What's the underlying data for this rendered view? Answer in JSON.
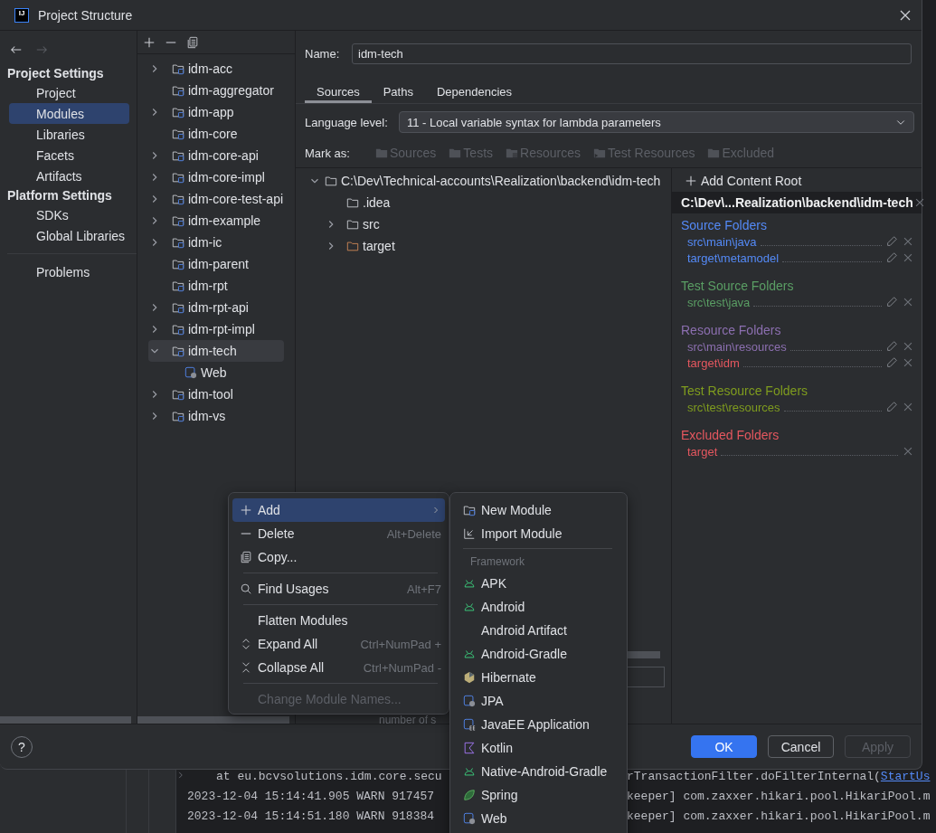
{
  "window": {
    "logo": "IJ",
    "title": "Project Structure"
  },
  "sidebar": {
    "groups": [
      {
        "heading": "Project Settings",
        "items": [
          {
            "label": "Project",
            "selected": false
          },
          {
            "label": "Modules",
            "selected": true
          },
          {
            "label": "Libraries",
            "selected": false
          },
          {
            "label": "Facets",
            "selected": false
          },
          {
            "label": "Artifacts",
            "selected": false
          }
        ]
      },
      {
        "heading": "Platform Settings",
        "items": [
          {
            "label": "SDKs",
            "selected": false
          },
          {
            "label": "Global Libraries",
            "selected": false
          }
        ]
      }
    ],
    "footer_items": [
      {
        "label": "Problems",
        "selected": false
      }
    ]
  },
  "modules": {
    "items": [
      {
        "label": "idm-acc",
        "expanded": false,
        "selected": false
      },
      {
        "label": "idm-aggregator",
        "selected": false
      },
      {
        "label": "idm-app",
        "expanded": false,
        "selected": false
      },
      {
        "label": "idm-core",
        "selected": false
      },
      {
        "label": "idm-core-api",
        "expanded": false,
        "selected": false
      },
      {
        "label": "idm-core-impl",
        "expanded": false,
        "selected": false
      },
      {
        "label": "idm-core-test-api",
        "expanded": false,
        "selected": false
      },
      {
        "label": "idm-example",
        "expanded": false,
        "selected": false
      },
      {
        "label": "idm-ic",
        "expanded": false,
        "selected": false
      },
      {
        "label": "idm-parent",
        "selected": false
      },
      {
        "label": "idm-rpt",
        "selected": false
      },
      {
        "label": "idm-rpt-api",
        "expanded": false,
        "selected": false
      },
      {
        "label": "idm-rpt-impl",
        "expanded": false,
        "selected": false
      },
      {
        "label": "idm-tech",
        "expanded": true,
        "selected": true,
        "children": [
          {
            "label": "Web",
            "kind": "web",
            "selected": false
          }
        ]
      },
      {
        "label": "idm-tool",
        "expanded": false,
        "selected": false
      },
      {
        "label": "idm-vs",
        "expanded": false,
        "selected": false
      }
    ]
  },
  "name_field": {
    "label": "Name:",
    "value": "idm-tech"
  },
  "tabs": [
    {
      "label": "Sources",
      "selected": true
    },
    {
      "label": "Paths",
      "selected": false
    },
    {
      "label": "Dependencies",
      "selected": false
    }
  ],
  "language_level": {
    "label": "Language level:",
    "value": "11 - Local variable syntax for lambda parameters"
  },
  "mark_as": {
    "label": "Mark as:",
    "buttons": [
      {
        "label": "Sources",
        "kind": "plain",
        "disabled": true
      },
      {
        "label": "Tests",
        "kind": "plain",
        "disabled": true
      },
      {
        "label": "Resources",
        "kind": "resources",
        "disabled": true
      },
      {
        "label": "Test Resources",
        "kind": "test-resources",
        "disabled": true
      },
      {
        "label": "Excluded",
        "kind": "plain",
        "disabled": true
      }
    ]
  },
  "content_tree": {
    "label": "C:\\Dev\\Technical-accounts\\Realization\\backend\\idm-tech",
    "expanded": true,
    "children": [
      {
        "label": ".idea",
        "kind": "folder"
      },
      {
        "label": "src",
        "kind": "folder",
        "expanded": false
      },
      {
        "label": "target",
        "kind": "excluded",
        "expanded": false
      }
    ]
  },
  "behind_menu": {
    "text": "number of s"
  },
  "content_roots": {
    "add_button": "Add Content Root",
    "root_path": "C:\\Dev\\...Realization\\backend\\idm-tech",
    "groups": [
      {
        "heading": "Source Folders",
        "color": "#548af7",
        "entries": [
          {
            "path": "src\\main\\java",
            "color": "#548af7",
            "editable": true
          },
          {
            "path": "target\\metamodel",
            "color": "#548af7",
            "editable": true
          }
        ]
      },
      {
        "heading": "Test Source Folders",
        "color": "#5a9e64",
        "entries": [
          {
            "path": "src\\test\\java",
            "color": "#5a9e64",
            "editable": true
          }
        ]
      },
      {
        "heading": "Resource Folders",
        "color": "#8c6fb0",
        "entries": [
          {
            "path": "src\\main\\resources",
            "color": "#8c6fb0",
            "editable": true
          },
          {
            "path": "target\\idm",
            "color": "#e5575f",
            "editable": true
          }
        ]
      },
      {
        "heading": "Test Resource Folders",
        "color": "#7f9c1e",
        "entries": [
          {
            "path": "src\\test\\resources",
            "color": "#7f9c1e",
            "editable": true
          }
        ]
      },
      {
        "heading": "Excluded Folders",
        "color": "#e5575f",
        "entries": [
          {
            "path": "target",
            "color": "#e5575f",
            "editable": false
          }
        ]
      }
    ]
  },
  "footer": {
    "help": "?",
    "buttons": [
      {
        "label": "OK",
        "kind": "primary",
        "disabled": false
      },
      {
        "label": "Cancel",
        "kind": "normal",
        "disabled": false
      },
      {
        "label": "Apply",
        "kind": "normal",
        "disabled": true
      }
    ]
  },
  "context_menu": {
    "groups": [
      [
        {
          "label": "Add",
          "has_submenu": true,
          "selected": true,
          "disabled": false
        },
        {
          "label": "Delete",
          "shortcut": "Alt+Delete",
          "has_submenu": false,
          "selected": false,
          "disabled": false
        },
        {
          "label": "Copy...",
          "has_submenu": false,
          "selected": false,
          "disabled": false
        }
      ],
      [
        {
          "label": "Find Usages",
          "shortcut": "Alt+F7",
          "has_submenu": false,
          "selected": false,
          "disabled": false
        }
      ],
      [
        {
          "label": "Flatten Modules",
          "has_submenu": false,
          "selected": false,
          "disabled": false
        },
        {
          "label": "Expand All",
          "shortcut": "Ctrl+NumPad +",
          "has_submenu": false,
          "selected": false,
          "disabled": false
        },
        {
          "label": "Collapse All",
          "shortcut": "Ctrl+NumPad -",
          "has_submenu": false,
          "selected": false,
          "disabled": false
        }
      ],
      [
        {
          "label": "Change Module Names...",
          "has_submenu": false,
          "selected": false,
          "disabled": true
        }
      ]
    ]
  },
  "submenu": {
    "items": [
      {
        "label": "New Module"
      },
      {
        "label": "Import Module"
      }
    ],
    "section_title": "Framework",
    "framework_items": [
      {
        "label": "APK"
      },
      {
        "label": "Android"
      },
      {
        "label": "Android Artifact"
      },
      {
        "label": "Android-Gradle"
      },
      {
        "label": "Hibernate"
      },
      {
        "label": "JPA"
      },
      {
        "label": "JavaEE Application"
      },
      {
        "label": "Kotlin"
      },
      {
        "label": "Native-Android-Gradle"
      },
      {
        "label": "Spring"
      },
      {
        "label": "Web"
      }
    ]
  },
  "console": {
    "lines": [
      {
        "left": "at eu.bcvsolutions.idm.core.secu",
        "right": "rTransactionFilter.doFilterInternal(",
        "link": "StartUs",
        "prompt": true
      },
      {
        "left": "2023-12-04 15:14:41.905  WARN 917457",
        "right": "keeper] com.zaxxer.hikari.pool.HikariPool.m",
        "prompt": false
      },
      {
        "left": "2023-12-04 15:14:51.180  WARN 918384",
        "right": "keeper] com.zaxxer.hikari.pool.HikariPool.m",
        "prompt": false
      }
    ]
  }
}
